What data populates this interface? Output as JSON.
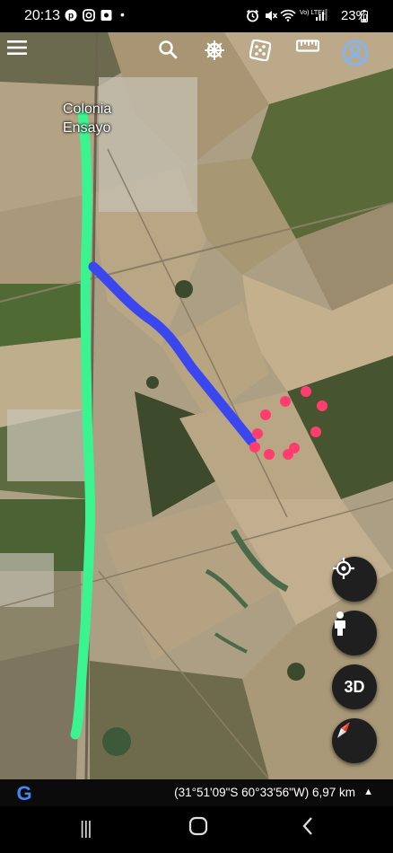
{
  "status_bar": {
    "time": "20:13",
    "battery": "23%",
    "network": "Vo) LTE1"
  },
  "toolbar": {
    "icons": [
      "menu-icon",
      "search-icon",
      "voyager-wheel-icon",
      "dice-icon",
      "ruler-icon",
      "account-icon"
    ]
  },
  "map": {
    "place_label_line1": "Colonia",
    "place_label_line2": "Ensayo",
    "overlay_colors": {
      "green_route": "#3af58f",
      "blue_route": "#3a46ee",
      "red_markers": "#ff3d6e"
    }
  },
  "map_controls": {
    "three_d_label": "3D"
  },
  "bottom_info": {
    "google_logo": "G",
    "coordinates": "(31°51'09\"S 60°33'56\"W) 6,97 km",
    "caret": "▲"
  },
  "nav_bar": {
    "recent": "|||",
    "home": "○",
    "back": "<"
  }
}
